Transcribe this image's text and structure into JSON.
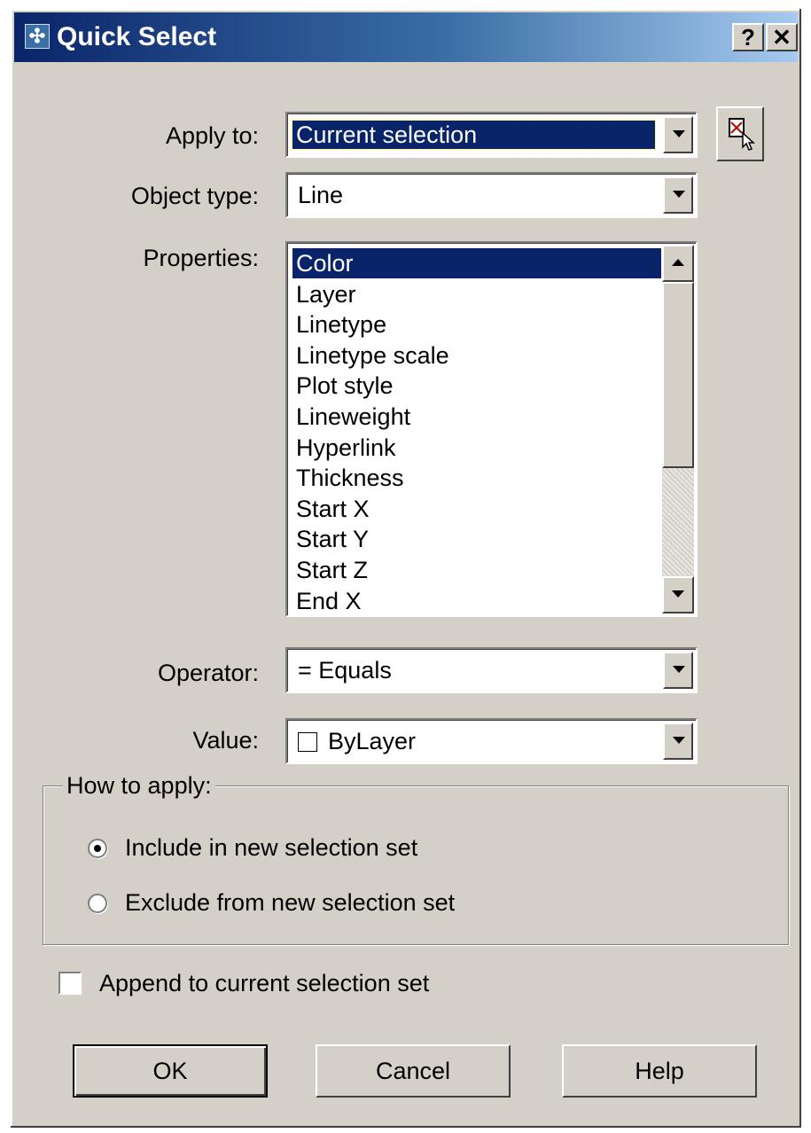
{
  "window": {
    "title": "Quick Select",
    "help_button": "?",
    "close_button": "✕"
  },
  "form": {
    "apply_to": {
      "label": "Apply to:",
      "value": "Current selection"
    },
    "object_type": {
      "label": "Object type:",
      "value": "Line"
    },
    "properties": {
      "label": "Properties:",
      "items": [
        "Color",
        "Layer",
        "Linetype",
        "Linetype scale",
        "Plot style",
        "Lineweight",
        "Hyperlink",
        "Thickness",
        "Start X",
        "Start Y",
        "Start Z",
        "End X"
      ],
      "selected": "Color"
    },
    "operator": {
      "label": "Operator:",
      "value": "= Equals"
    },
    "value": {
      "label": "Value:",
      "value": "ByLayer"
    }
  },
  "how_to_apply": {
    "legend": "How to apply:",
    "include_label": "Include in new selection set",
    "exclude_label": "Exclude from new selection set",
    "selected": "include"
  },
  "append": {
    "label": "Append to current selection set",
    "checked": false
  },
  "buttons": {
    "ok": "OK",
    "cancel": "Cancel",
    "help": "Help"
  }
}
